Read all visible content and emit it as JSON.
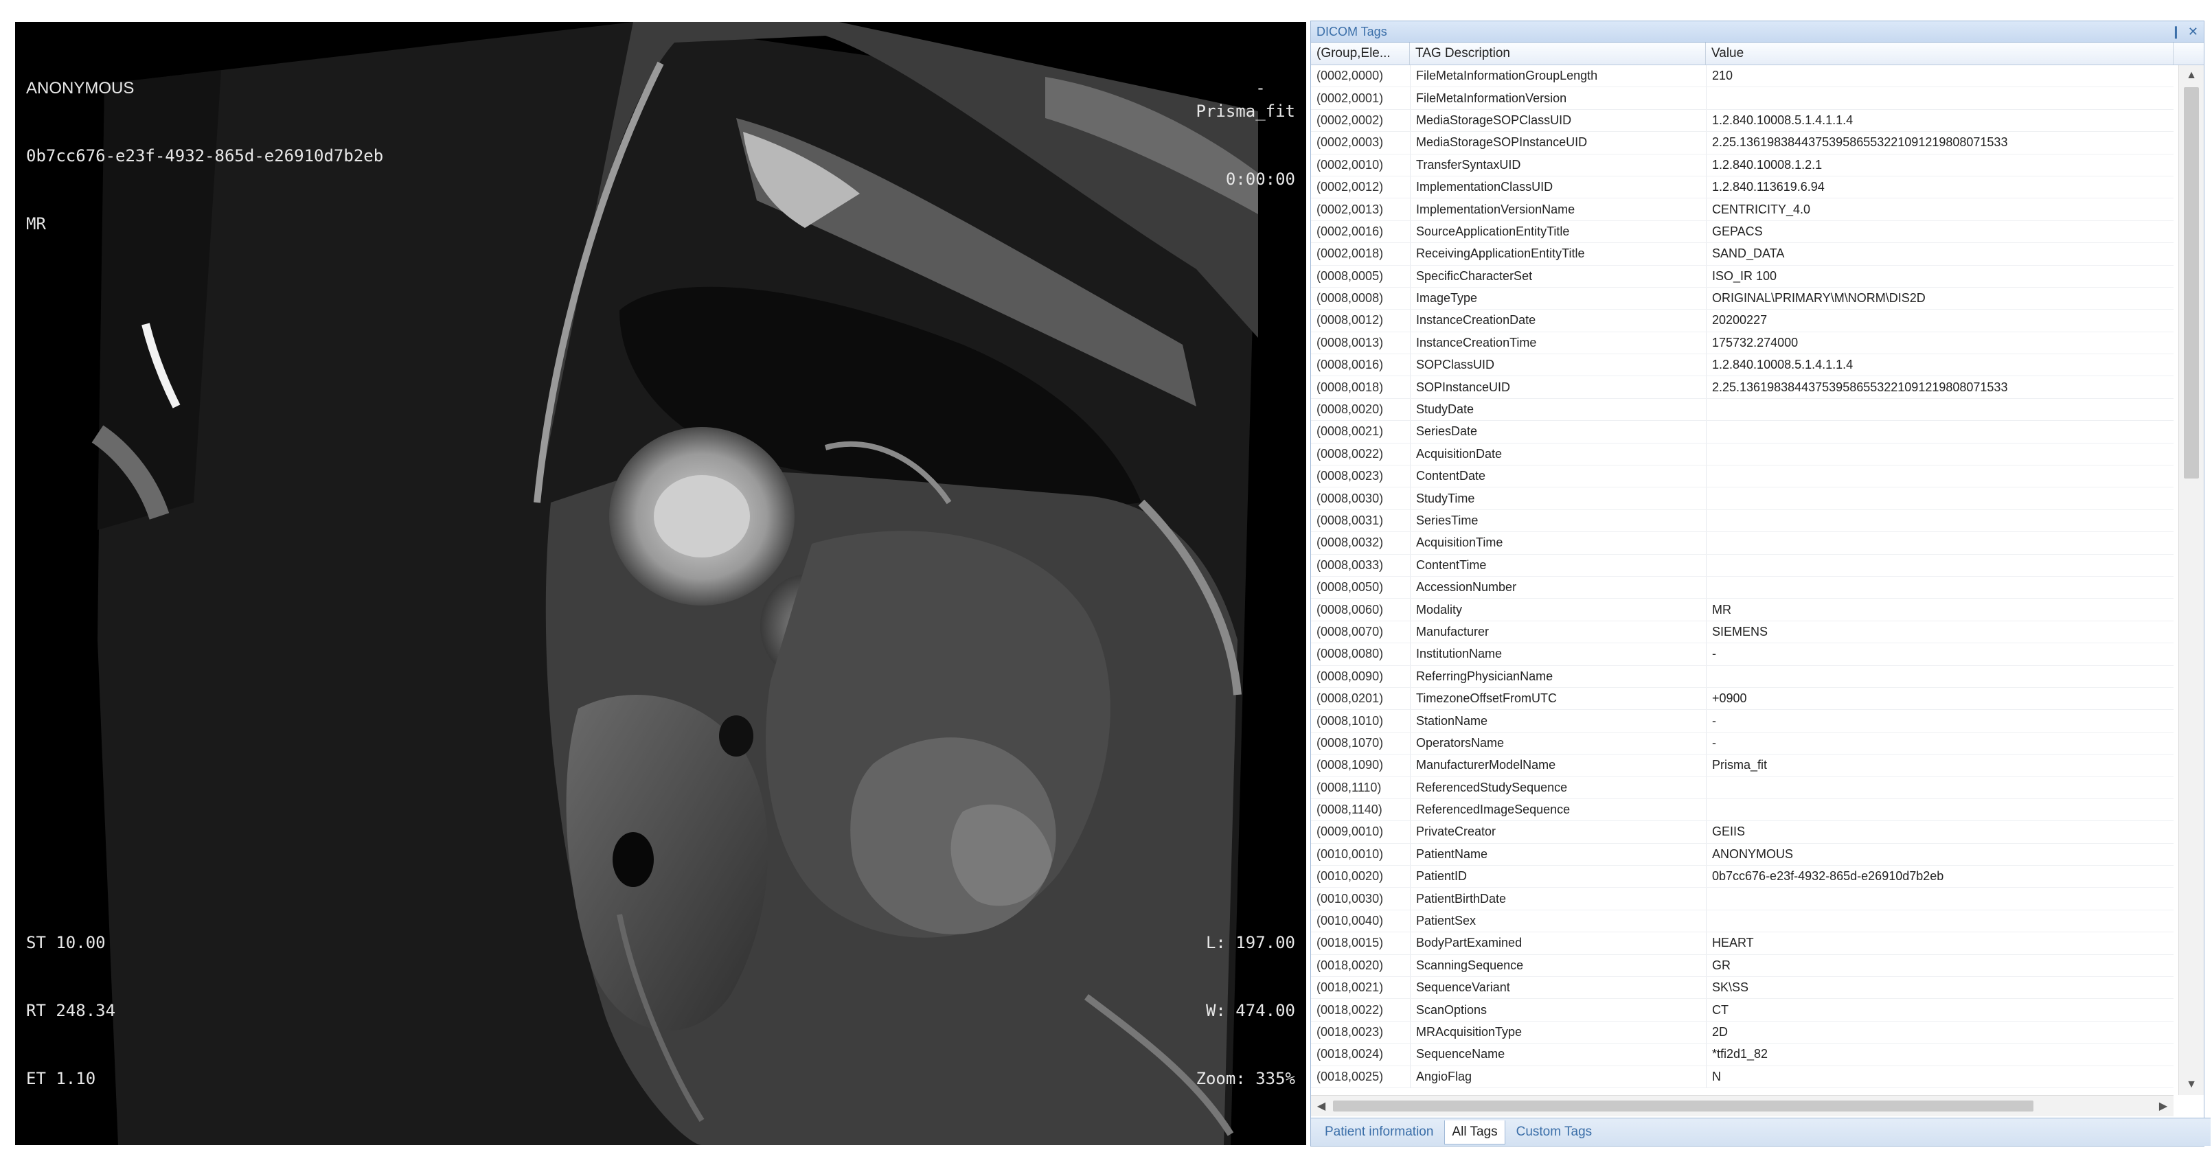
{
  "viewer": {
    "top_left": [
      "ANONYMOUS",
      "0b7cc676-e23f-4932-865d-e26910d7b2eb",
      "MR"
    ],
    "top_right_dash": "-",
    "top_right": [
      "Prisma_fit",
      "0:00:00"
    ],
    "bottom_left": [
      "ST 10.00",
      "RT 248.34",
      "ET 1.10"
    ],
    "bottom_right": [
      "L: 197.00",
      "W: 474.00",
      "Zoom: 335%"
    ]
  },
  "panel": {
    "title": "DICOM Tags",
    "pin_icon": "pin-icon",
    "close_icon": "close-icon",
    "columns": [
      "(Group,Ele...",
      "TAG Description",
      "Value"
    ],
    "rows": [
      [
        "(0002,0000)",
        "FileMetaInformationGroupLength",
        "210"
      ],
      [
        "(0002,0001)",
        "FileMetaInformationVersion",
        ""
      ],
      [
        "(0002,0002)",
        "MediaStorageSOPClassUID",
        "1.2.840.10008.5.1.4.1.1.4"
      ],
      [
        "(0002,0003)",
        "MediaStorageSOPInstanceUID",
        "2.25.136198384437539586553221091219808071533"
      ],
      [
        "(0002,0010)",
        "TransferSyntaxUID",
        "1.2.840.10008.1.2.1"
      ],
      [
        "(0002,0012)",
        "ImplementationClassUID",
        "1.2.840.113619.6.94"
      ],
      [
        "(0002,0013)",
        "ImplementationVersionName",
        "CENTRICITY_4.0"
      ],
      [
        "(0002,0016)",
        "SourceApplicationEntityTitle",
        "GEPACS"
      ],
      [
        "(0002,0018)",
        "ReceivingApplicationEntityTitle",
        "SAND_DATA"
      ],
      [
        "(0008,0005)",
        "SpecificCharacterSet",
        "ISO_IR 100"
      ],
      [
        "(0008,0008)",
        "ImageType",
        "ORIGINAL\\PRIMARY\\M\\NORM\\DIS2D"
      ],
      [
        "(0008,0012)",
        "InstanceCreationDate",
        "20200227"
      ],
      [
        "(0008,0013)",
        "InstanceCreationTime",
        "175732.274000"
      ],
      [
        "(0008,0016)",
        "SOPClassUID",
        "1.2.840.10008.5.1.4.1.1.4"
      ],
      [
        "(0008,0018)",
        "SOPInstanceUID",
        "2.25.136198384437539586553221091219808071533"
      ],
      [
        "(0008,0020)",
        "StudyDate",
        ""
      ],
      [
        "(0008,0021)",
        "SeriesDate",
        ""
      ],
      [
        "(0008,0022)",
        "AcquisitionDate",
        ""
      ],
      [
        "(0008,0023)",
        "ContentDate",
        ""
      ],
      [
        "(0008,0030)",
        "StudyTime",
        ""
      ],
      [
        "(0008,0031)",
        "SeriesTime",
        ""
      ],
      [
        "(0008,0032)",
        "AcquisitionTime",
        ""
      ],
      [
        "(0008,0033)",
        "ContentTime",
        ""
      ],
      [
        "(0008,0050)",
        "AccessionNumber",
        ""
      ],
      [
        "(0008,0060)",
        "Modality",
        "MR"
      ],
      [
        "(0008,0070)",
        "Manufacturer",
        "SIEMENS"
      ],
      [
        "(0008,0080)",
        "InstitutionName",
        "-"
      ],
      [
        "(0008,0090)",
        "ReferringPhysicianName",
        ""
      ],
      [
        "(0008,0201)",
        "TimezoneOffsetFromUTC",
        "+0900"
      ],
      [
        "(0008,1010)",
        "StationName",
        "-"
      ],
      [
        "(0008,1070)",
        "OperatorsName",
        "-"
      ],
      [
        "(0008,1090)",
        "ManufacturerModelName",
        "Prisma_fit"
      ],
      [
        "(0008,1110)",
        "ReferencedStudySequence",
        ""
      ],
      [
        "(0008,1140)",
        "ReferencedImageSequence",
        ""
      ],
      [
        "(0009,0010)",
        "PrivateCreator",
        "GEIIS"
      ],
      [
        "(0010,0010)",
        "PatientName",
        "ANONYMOUS"
      ],
      [
        "(0010,0020)",
        "PatientID",
        "0b7cc676-e23f-4932-865d-e26910d7b2eb"
      ],
      [
        "(0010,0030)",
        "PatientBirthDate",
        ""
      ],
      [
        "(0010,0040)",
        "PatientSex",
        ""
      ],
      [
        "(0018,0015)",
        "BodyPartExamined",
        "HEART"
      ],
      [
        "(0018,0020)",
        "ScanningSequence",
        "GR"
      ],
      [
        "(0018,0021)",
        "SequenceVariant",
        "SK\\SS"
      ],
      [
        "(0018,0022)",
        "ScanOptions",
        "CT"
      ],
      [
        "(0018,0023)",
        "MRAcquisitionType",
        "2D"
      ],
      [
        "(0018,0024)",
        "SequenceName",
        "*tfi2d1_82"
      ],
      [
        "(0018,0025)",
        "AngioFlag",
        "N"
      ]
    ],
    "tabs": [
      "Patient information",
      "All Tags",
      "Custom Tags"
    ],
    "active_tab": "All Tags"
  }
}
